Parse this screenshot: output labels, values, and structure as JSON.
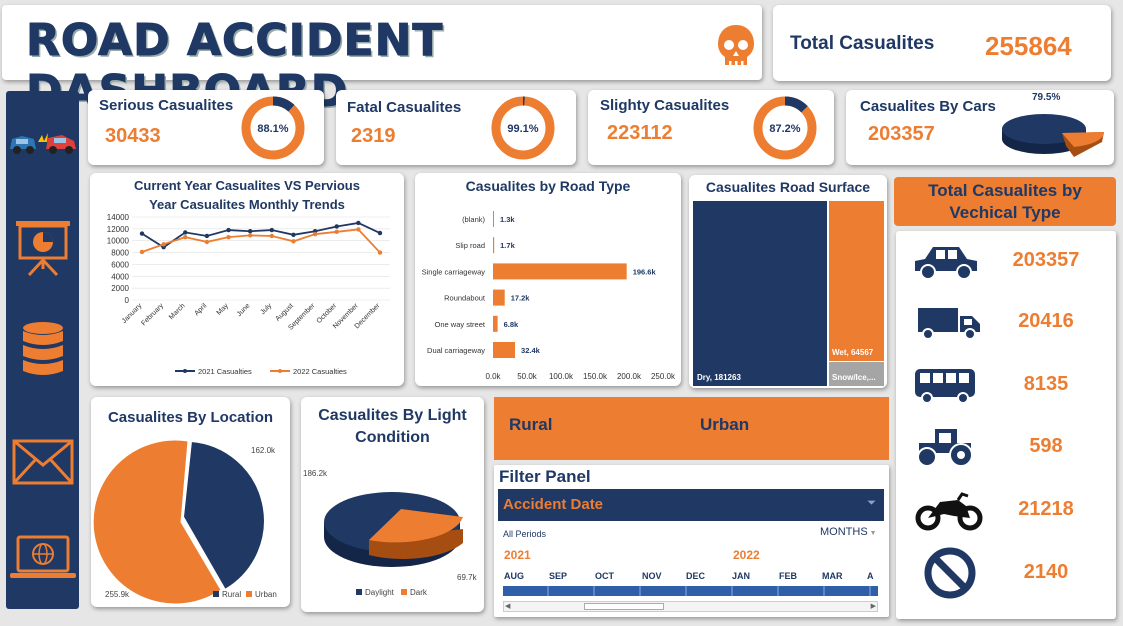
{
  "header": {
    "title": "ROAD ACCIDENT DASHBOARD",
    "icon": "skull-icon"
  },
  "total": {
    "label": "Total Casualites",
    "value": "255864"
  },
  "kpis": [
    {
      "label": "Serious Casualites",
      "value": "30433",
      "pct_label": "88.1%",
      "pct": 0.881
    },
    {
      "label": "Fatal Casualites",
      "value": "2319",
      "pct_label": "99.1%",
      "pct": 0.991
    },
    {
      "label": "Slighty Casualites",
      "value": "223112",
      "pct_label": "87.2%",
      "pct": 0.872
    },
    {
      "label": "Casualites By Cars",
      "value": "203357",
      "pct_label": "79.5%",
      "pct": 0.795
    }
  ],
  "sidebar": {
    "icons": [
      "car-crash-icon",
      "presentation-icon",
      "database-icon",
      "mail-icon",
      "laptop-globe-icon"
    ]
  },
  "trend_chart": {
    "title_line1": "Current Year Casualites VS Pervious",
    "title_line2": "Year Casualites Monthly Trends",
    "y_ticks": [
      "14000",
      "12000",
      "10000",
      "8000",
      "6000",
      "4000",
      "2000",
      "0"
    ],
    "legend": [
      "2021 Casualties",
      "2022 Casualties"
    ]
  },
  "road_type_chart": {
    "title": "Casualites by Road Type",
    "x_ticks": [
      "0.0k",
      "50.0k",
      "100.0k",
      "150.0k",
      "200.0k",
      "250.0k"
    ]
  },
  "surface_chart": {
    "title": "Casualites Road Surface",
    "labels": {
      "dry": "Dry, 181263",
      "wet": "Wet, 64567",
      "snow": "Snow/Ice,..."
    }
  },
  "location_chart": {
    "title": "Casualites By Location",
    "labels": [
      "162.0k",
      "255.9k"
    ],
    "legend": [
      "Rural",
      "Urban"
    ]
  },
  "light_chart": {
    "title_line1": "Casualites By Light",
    "title_line2": "Condition",
    "labels": [
      "186.2k",
      "69.7k"
    ],
    "legend": [
      "Daylight",
      "Dark"
    ]
  },
  "area_slicer": {
    "items": [
      "Rural",
      "Urban"
    ]
  },
  "filter_panel": {
    "title": "Filter Panel",
    "header": "Accident Date",
    "periods": "All Periods",
    "granularity": "MONTHS",
    "years": [
      "2021",
      "2022"
    ],
    "months": [
      "AUG",
      "SEP",
      "OCT",
      "NOV",
      "DEC",
      "JAN",
      "FEB",
      "MAR",
      "A"
    ]
  },
  "vehicle_panel": {
    "title_line1": "Total Casualites by",
    "title_line2": "Vechical Type",
    "items": [
      {
        "icon": "car-icon",
        "value": "203357"
      },
      {
        "icon": "truck-icon",
        "value": "20416"
      },
      {
        "icon": "bus-icon",
        "value": "8135"
      },
      {
        "icon": "tractor-icon",
        "value": "598"
      },
      {
        "icon": "motorcycle-icon",
        "value": "21218"
      },
      {
        "icon": "no-symbol-icon",
        "value": "2140"
      }
    ]
  },
  "chart_data": [
    {
      "type": "line",
      "title": "Current Year Casualites VS Pervious Year Casualites Monthly Trends",
      "categories": [
        "January",
        "February",
        "March",
        "April",
        "May",
        "June",
        "July",
        "August",
        "September",
        "October",
        "November",
        "December"
      ],
      "series": [
        {
          "name": "2021 Casualties",
          "values": [
            11200,
            8900,
            11400,
            10800,
            11800,
            11600,
            11800,
            11000,
            11600,
            12400,
            13000,
            11300
          ]
        },
        {
          "name": "2022 Casualties",
          "values": [
            8100,
            9400,
            10600,
            9800,
            10600,
            10900,
            10800,
            9900,
            11100,
            11500,
            11900,
            8000
          ]
        }
      ],
      "ylim": [
        0,
        14000
      ],
      "colors": [
        "#1f3864",
        "#ed7d31"
      ]
    },
    {
      "type": "bar",
      "title": "Casualites by Road Type",
      "categories": [
        "(blank)",
        "Slip road",
        "Single carriageway",
        "Roundabout",
        "One way street",
        "Dual carriageway"
      ],
      "values": [
        1300,
        1700,
        196600,
        17200,
        6800,
        32400
      ],
      "data_labels": [
        "1.3k",
        "1.7k",
        "196.6k",
        "17.2k",
        "6.8k",
        "32.4k"
      ],
      "xlim": [
        0,
        250000
      ],
      "orientation": "horizontal"
    },
    {
      "type": "treemap",
      "title": "Casualites Road Surface",
      "categories": [
        "Dry",
        "Wet",
        "Snow/Ice"
      ],
      "values": [
        181263,
        64567,
        10034
      ]
    },
    {
      "type": "pie",
      "title": "Casualites By Location",
      "categories": [
        "Rural",
        "Urban"
      ],
      "values": [
        162000,
        255900
      ]
    },
    {
      "type": "pie",
      "title": "Casualites By Light Condition",
      "categories": [
        "Daylight",
        "Dark"
      ],
      "values": [
        186200,
        69700
      ]
    }
  ]
}
